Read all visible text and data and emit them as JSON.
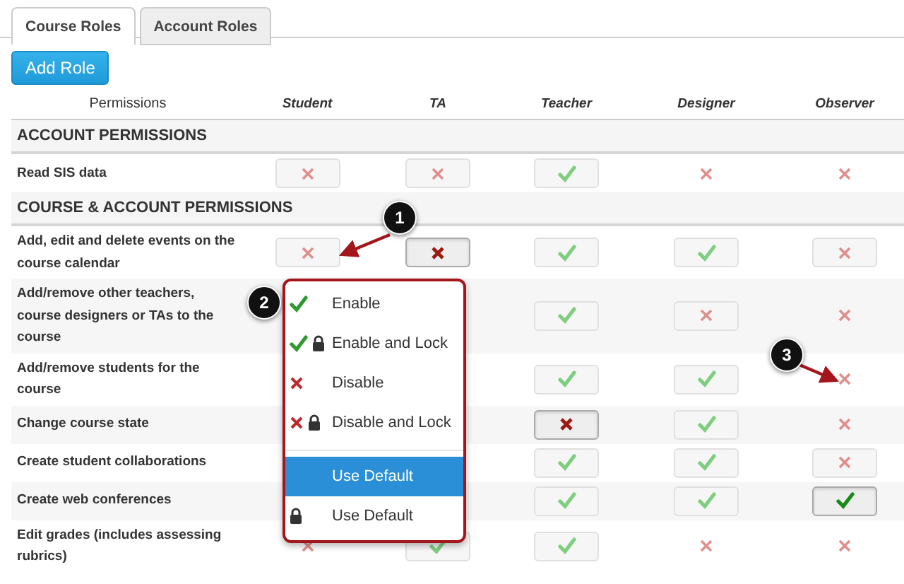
{
  "tabs": [
    {
      "label": "Course Roles",
      "selected": true
    },
    {
      "label": "Account Roles",
      "selected": false
    }
  ],
  "add_button": "Add Role",
  "table": {
    "columns": [
      "Permissions",
      "Student",
      "TA",
      "Teacher",
      "Designer",
      "Observer"
    ],
    "rows": [
      {
        "kind": "section",
        "label": "ACCOUNT PERMISSIONS"
      },
      {
        "kind": "permission",
        "label": "Read SIS data",
        "cells": [
          {
            "enabled": false,
            "button": true,
            "explicit": false
          },
          {
            "enabled": false,
            "button": true,
            "explicit": false
          },
          {
            "enabled": true,
            "button": true,
            "explicit": false
          },
          {
            "enabled": false,
            "button": false,
            "explicit": false
          },
          {
            "enabled": false,
            "button": false,
            "explicit": false
          }
        ]
      },
      {
        "kind": "section",
        "label": "COURSE & ACCOUNT PERMISSIONS"
      },
      {
        "kind": "permission",
        "label": "Add, edit and delete events on the course calendar",
        "cells": [
          {
            "enabled": false,
            "button": true,
            "explicit": false
          },
          {
            "enabled": false,
            "button": true,
            "explicit": true
          },
          {
            "enabled": true,
            "button": true,
            "explicit": false
          },
          {
            "enabled": true,
            "button": true,
            "explicit": false
          },
          {
            "enabled": false,
            "button": true,
            "explicit": false
          }
        ]
      },
      {
        "kind": "permission",
        "label": "Add/remove other teachers, course designers or TAs to the course",
        "cells": [
          null,
          null,
          {
            "enabled": true,
            "button": true,
            "explicit": false
          },
          {
            "enabled": false,
            "button": true,
            "explicit": false
          },
          {
            "enabled": false,
            "button": false,
            "explicit": false
          }
        ]
      },
      {
        "kind": "permission",
        "label": "Add/remove students for the course",
        "cells": [
          null,
          null,
          {
            "enabled": true,
            "button": true,
            "explicit": false
          },
          {
            "enabled": true,
            "button": true,
            "explicit": false
          },
          {
            "enabled": false,
            "button": false,
            "explicit": false
          }
        ]
      },
      {
        "kind": "permission",
        "label": "Change course state",
        "cells": [
          null,
          null,
          {
            "enabled": false,
            "button": true,
            "explicit": true
          },
          {
            "enabled": true,
            "button": true,
            "explicit": false
          },
          {
            "enabled": false,
            "button": false,
            "explicit": false
          }
        ]
      },
      {
        "kind": "permission",
        "label": "Create student collaborations",
        "cells": [
          null,
          null,
          {
            "enabled": true,
            "button": true,
            "explicit": false
          },
          {
            "enabled": true,
            "button": true,
            "explicit": false
          },
          {
            "enabled": false,
            "button": true,
            "explicit": false
          }
        ]
      },
      {
        "kind": "permission",
        "label": "Create web conferences",
        "cells": [
          null,
          null,
          {
            "enabled": true,
            "button": true,
            "explicit": false
          },
          {
            "enabled": true,
            "button": true,
            "explicit": false
          },
          {
            "enabled": true,
            "button": true,
            "explicit": true
          }
        ]
      },
      {
        "kind": "permission",
        "label": "Edit grades (includes assessing rubrics)",
        "cells": [
          {
            "enabled": false,
            "button": false,
            "explicit": false
          },
          {
            "enabled": true,
            "button": true,
            "explicit": false
          },
          {
            "enabled": true,
            "button": true,
            "explicit": false
          },
          {
            "enabled": false,
            "button": false,
            "explicit": false
          },
          {
            "enabled": false,
            "button": false,
            "explicit": false
          }
        ]
      }
    ]
  },
  "menu": [
    {
      "kind": "enable",
      "label": "Enable",
      "selected": false
    },
    {
      "kind": "enable-lock",
      "label": "Enable and Lock",
      "selected": false
    },
    {
      "kind": "disable",
      "label": "Disable",
      "selected": false
    },
    {
      "kind": "disable-lock",
      "label": "Disable and Lock",
      "selected": false
    },
    {
      "kind": "default",
      "label": "Use Default",
      "selected": true
    },
    {
      "kind": "default-lock",
      "label": "Use Default",
      "selected": false
    }
  ],
  "callouts": [
    "1",
    "2",
    "3"
  ]
}
